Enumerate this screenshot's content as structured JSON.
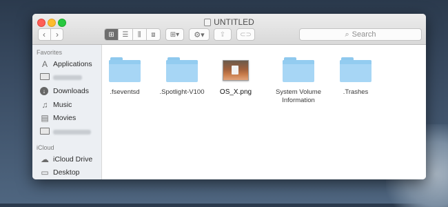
{
  "window": {
    "title": "UNTITLED"
  },
  "toolbar": {
    "back_icon": "chevron-left-icon",
    "forward_icon": "chevron-right-icon",
    "views": [
      "icon-view-icon",
      "list-view-icon",
      "column-view-icon",
      "cover-flow-icon"
    ],
    "active_view_index": 0,
    "search_placeholder": "Search"
  },
  "sidebar": {
    "favorites_header": "Favorites",
    "favorites": [
      {
        "label": "Applications",
        "icon": "applications-icon"
      },
      {
        "label": "",
        "icon": "folder-icon",
        "redacted": true
      },
      {
        "label": "Downloads",
        "icon": "downloads-icon"
      },
      {
        "label": "Music",
        "icon": "music-icon"
      },
      {
        "label": "Movies",
        "icon": "movies-icon"
      },
      {
        "label": "",
        "icon": "folder-icon",
        "redacted": true
      }
    ],
    "icloud_header": "iCloud",
    "icloud": [
      {
        "label": "iCloud Drive",
        "icon": "cloud-icon"
      },
      {
        "label": "Desktop",
        "icon": "desktop-icon"
      }
    ]
  },
  "files": [
    {
      "name": ".fseventsd",
      "kind": "folder"
    },
    {
      "name": ".Spotlight-V100",
      "kind": "folder"
    },
    {
      "name": "OS_X.png",
      "kind": "image"
    },
    {
      "name": "System Volume",
      "name_line2": "Information",
      "kind": "folder"
    },
    {
      "name": ".Trashes",
      "kind": "folder"
    }
  ],
  "colors": {
    "folder_blue": "#a7d6f5",
    "close": "#ff5f57",
    "minimize": "#febc2e",
    "zoom": "#28c840"
  }
}
